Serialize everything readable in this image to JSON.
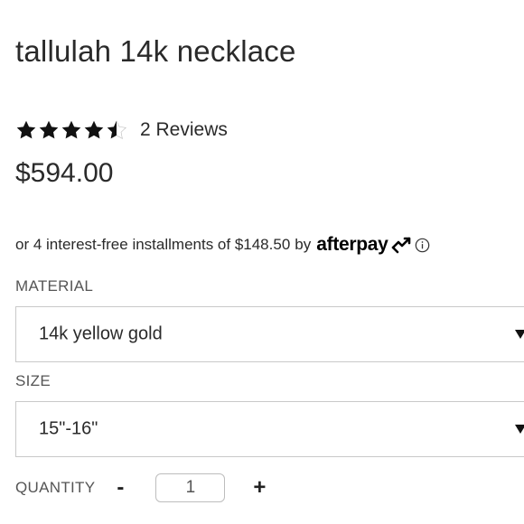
{
  "product": {
    "title": "tallulah 14k necklace",
    "rating": 4.5,
    "rating_max": 5,
    "reviews_label": "2 Reviews",
    "price": "$594.00"
  },
  "afterpay": {
    "prefix": "or 4 interest-free installments of $148.50",
    "by": "by",
    "brand": "afterpay"
  },
  "material": {
    "label": "MATERIAL",
    "selected": "14k yellow gold"
  },
  "size": {
    "label": "SIZE",
    "selected": "15\"-16\""
  },
  "quantity": {
    "label": "QUANTITY",
    "minus": "-",
    "value": "1",
    "plus": "+"
  },
  "icons": {
    "star": "star-icon",
    "dropdown": "triangle-down-icon",
    "info": "info-circle-icon",
    "afterpay_logo": "afterpay-arrows-icon"
  },
  "colors": {
    "text": "#222222",
    "border": "#c9c9c9"
  }
}
